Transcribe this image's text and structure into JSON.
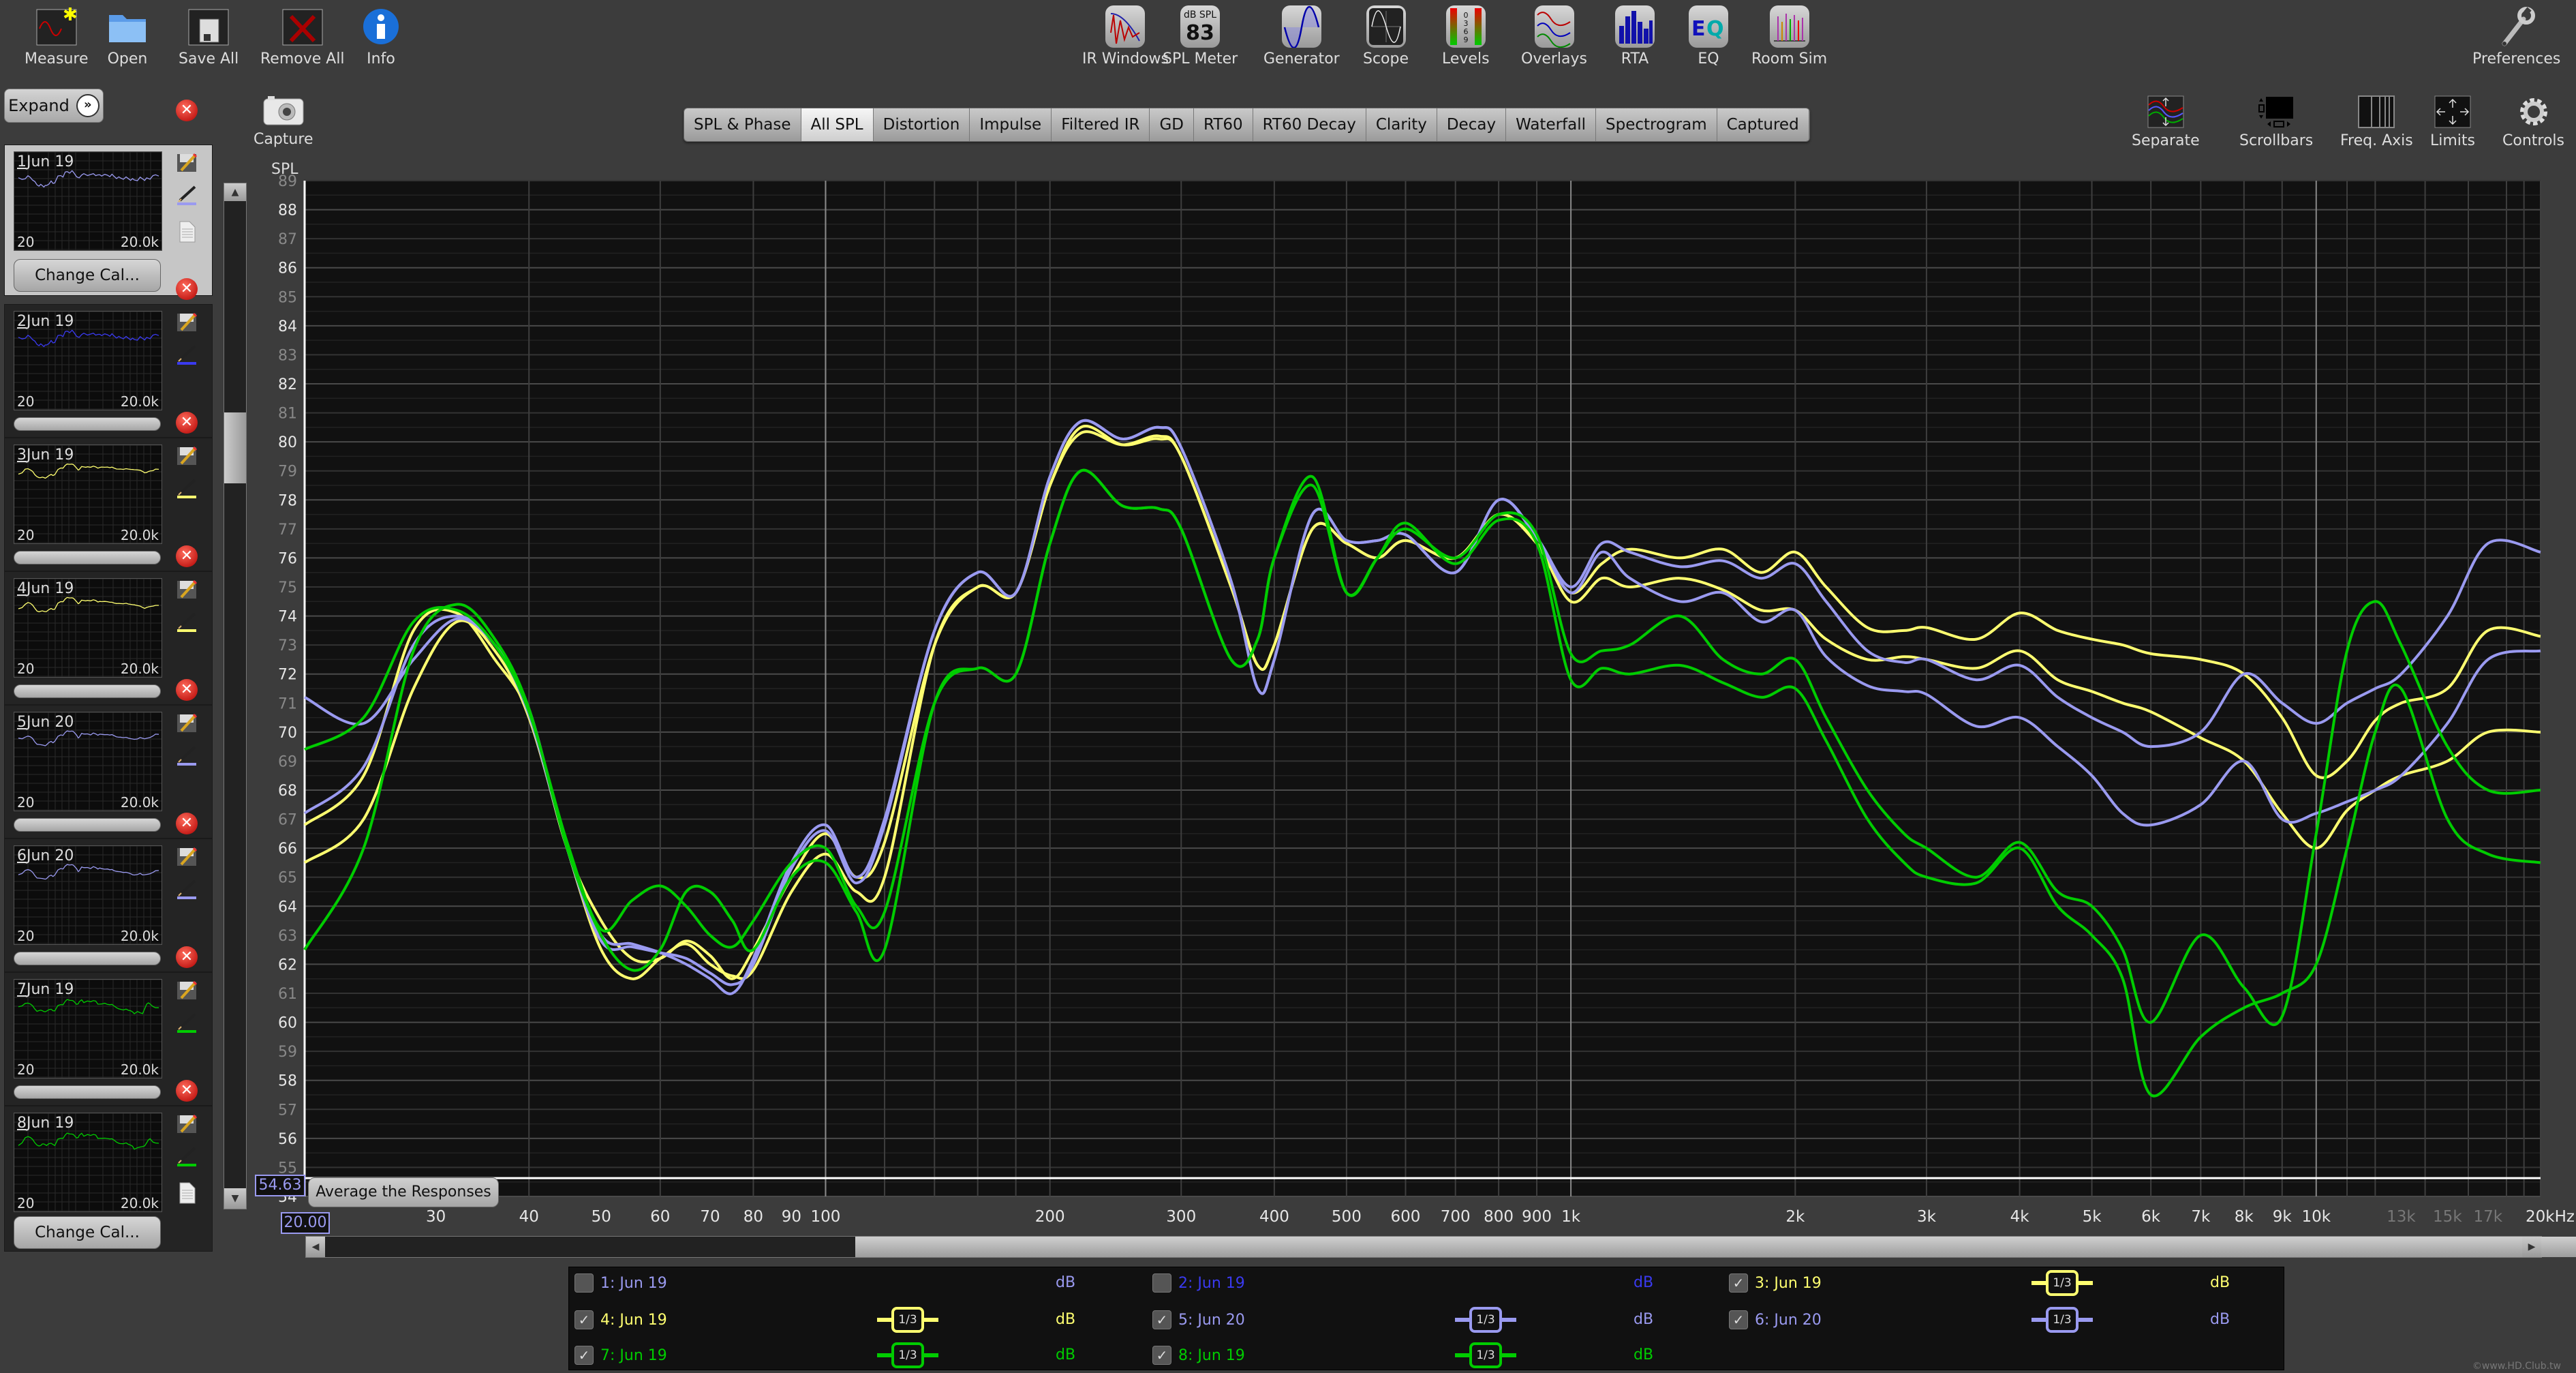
{
  "toolbar_left": [
    {
      "label": "Measure",
      "icon": "measure-icon"
    },
    {
      "label": "Open",
      "icon": "folder-icon"
    },
    {
      "label": "Save All",
      "icon": "save-all-icon"
    },
    {
      "label": "Remove All",
      "icon": "remove-all-icon"
    },
    {
      "label": "Info",
      "icon": "info-icon"
    }
  ],
  "toolbar_center": [
    {
      "label": "IR Windows",
      "icon": "ir-windows-icon"
    },
    {
      "label": "SPL Meter",
      "icon": "spl-meter-icon",
      "top": "dB SPL",
      "value": "83"
    },
    {
      "label": "Generator",
      "icon": "generator-icon"
    },
    {
      "label": "Scope",
      "icon": "scope-icon"
    },
    {
      "label": "Levels",
      "icon": "levels-icon"
    },
    {
      "label": "Overlays",
      "icon": "overlays-icon"
    },
    {
      "label": "RTA",
      "icon": "rta-icon"
    },
    {
      "label": "EQ",
      "icon": "eq-icon"
    },
    {
      "label": "Room Sim",
      "icon": "room-sim-icon"
    }
  ],
  "preferences": {
    "label": "Preferences",
    "icon": "wrench-icon"
  },
  "capture": {
    "label": "Capture",
    "icon": "camera-icon"
  },
  "right_controls": [
    {
      "label": "Separate",
      "icon": "separate-icon"
    },
    {
      "label": "Scrollbars",
      "icon": "scrollbars-icon"
    },
    {
      "label": "Freq. Axis",
      "icon": "freq-axis-icon"
    },
    {
      "label": "Limits",
      "icon": "limits-icon"
    },
    {
      "label": "Controls",
      "icon": "gear-icon"
    }
  ],
  "tabs": [
    {
      "label": "SPL & Phase",
      "active": false
    },
    {
      "label": "All SPL",
      "active": true
    },
    {
      "label": "Distortion",
      "active": false
    },
    {
      "label": "Impulse",
      "active": false
    },
    {
      "label": "Filtered IR",
      "active": false
    },
    {
      "label": "GD",
      "active": false
    },
    {
      "label": "RT60",
      "active": false
    },
    {
      "label": "RT60 Decay",
      "active": false
    },
    {
      "label": "Clarity",
      "active": false
    },
    {
      "label": "Decay",
      "active": false
    },
    {
      "label": "Waterfall",
      "active": false
    },
    {
      "label": "Spectrogram",
      "active": false
    },
    {
      "label": "Captured",
      "active": false
    }
  ],
  "expand_label": "Expand",
  "change_cal_label": "Change Cal...",
  "measurements": [
    {
      "num": "1",
      "name": "Jun 19",
      "color": "#9a9af0",
      "selected": true
    },
    {
      "num": "2",
      "name": "Jun 19",
      "color": "#3a3af0",
      "selected": false
    },
    {
      "num": "3",
      "name": "Jun 19",
      "color": "#ffff70",
      "selected": false
    },
    {
      "num": "4",
      "name": "Jun 19",
      "color": "#ffff70",
      "selected": false
    },
    {
      "num": "5",
      "name": "Jun 20",
      "color": "#9a9af0",
      "selected": false
    },
    {
      "num": "6",
      "name": "Jun 20",
      "color": "#9a9af0",
      "selected": false
    },
    {
      "num": "7",
      "name": "Jun 19",
      "color": "#00cc00",
      "selected": false
    },
    {
      "num": "8",
      "name": "Jun 19",
      "color": "#00cc00",
      "selected": false
    }
  ],
  "thumb_freq_low": "20",
  "thumb_freq_high": "20.0k",
  "average_button": "Average the Responses",
  "cursor_readout": {
    "spl": "54.63",
    "freq": "20.00"
  },
  "legend": [
    {
      "label": "1: Jun 19",
      "checked": false,
      "smoothing": "",
      "unit": "dB",
      "color": "#9a9af0"
    },
    {
      "label": "2: Jun 19",
      "checked": false,
      "smoothing": "",
      "unit": "dB",
      "color": "#3a3af0"
    },
    {
      "label": "3: Jun 19",
      "checked": true,
      "smoothing": "1/3",
      "unit": "dB",
      "color": "#ffff70"
    },
    {
      "label": "4: Jun 19",
      "checked": true,
      "smoothing": "1/3",
      "unit": "dB",
      "color": "#ffff70"
    },
    {
      "label": "5: Jun 20",
      "checked": true,
      "smoothing": "1/3",
      "unit": "dB",
      "color": "#9a9af0"
    },
    {
      "label": "6: Jun 20",
      "checked": true,
      "smoothing": "1/3",
      "unit": "dB",
      "color": "#9a9af0"
    },
    {
      "label": "7: Jun 19",
      "checked": true,
      "smoothing": "1/3",
      "unit": "dB",
      "color": "#00cc00"
    },
    {
      "label": "8: Jun 19",
      "checked": true,
      "smoothing": "1/3",
      "unit": "dB",
      "color": "#00cc00"
    }
  ],
  "watermark": "©www.HD.Club.tw",
  "chart_data": {
    "type": "line",
    "title": "All SPL",
    "ylabel": "SPL",
    "xlabel": "Hz",
    "xscale": "log",
    "xlim": [
      20,
      20000
    ],
    "ylim": [
      54,
      89
    ],
    "grid": true,
    "y_ticks": [
      54,
      55,
      56,
      57,
      58,
      59,
      60,
      61,
      62,
      63,
      64,
      65,
      66,
      67,
      68,
      69,
      70,
      71,
      72,
      73,
      74,
      75,
      76,
      77,
      78,
      79,
      80,
      81,
      82,
      83,
      84,
      85,
      86,
      87,
      88,
      89
    ],
    "x_ticks": [
      {
        "f": 30,
        "label": "30"
      },
      {
        "f": 40,
        "label": "40"
      },
      {
        "f": 50,
        "label": "50"
      },
      {
        "f": 60,
        "label": "60"
      },
      {
        "f": 70,
        "label": "70"
      },
      {
        "f": 80,
        "label": "80"
      },
      {
        "f": 90,
        "label": "90"
      },
      {
        "f": 100,
        "label": "100"
      },
      {
        "f": 200,
        "label": "200"
      },
      {
        "f": 300,
        "label": "300"
      },
      {
        "f": 400,
        "label": "400"
      },
      {
        "f": 500,
        "label": "500"
      },
      {
        "f": 600,
        "label": "600"
      },
      {
        "f": 700,
        "label": "700"
      },
      {
        "f": 800,
        "label": "800"
      },
      {
        "f": 900,
        "label": "900"
      },
      {
        "f": 1000,
        "label": "1k"
      },
      {
        "f": 2000,
        "label": "2k"
      },
      {
        "f": 3000,
        "label": "3k"
      },
      {
        "f": 4000,
        "label": "4k"
      },
      {
        "f": 5000,
        "label": "5k"
      },
      {
        "f": 6000,
        "label": "6k"
      },
      {
        "f": 7000,
        "label": "7k"
      },
      {
        "f": 8000,
        "label": "8k"
      },
      {
        "f": 9000,
        "label": "9k"
      },
      {
        "f": 10000,
        "label": "10k"
      },
      {
        "f": 13000,
        "label": "13k",
        "dim": true
      },
      {
        "f": 15000,
        "label": "15k",
        "dim": true
      },
      {
        "f": 17000,
        "label": "17k",
        "dim": true
      },
      {
        "f": 20000,
        "label": "20kHz"
      }
    ],
    "x": [
      20,
      24,
      28,
      32,
      36,
      40,
      45,
      50,
      55,
      60,
      65,
      70,
      75,
      80,
      90,
      100,
      110,
      120,
      140,
      160,
      180,
      200,
      220,
      250,
      280,
      300,
      350,
      380,
      400,
      450,
      500,
      550,
      600,
      700,
      800,
      900,
      1000,
      1100,
      1200,
      1400,
      1600,
      1800,
      2000,
      2200,
      2500,
      2800,
      3000,
      3500,
      4000,
      4500,
      5000,
      5500,
      6000,
      7000,
      8000,
      9000,
      10000,
      11000,
      12000,
      13000,
      15000,
      17000,
      20000
    ],
    "series": [
      {
        "name": "3: Jun 19",
        "color": "#ffff70",
        "values": [
          66.8,
          68.5,
          73.5,
          74.1,
          72.5,
          70.6,
          66.0,
          63.5,
          62.2,
          62.2,
          62.8,
          62.3,
          61.5,
          62.5,
          65.0,
          66.5,
          65.0,
          66.2,
          73.0,
          75.0,
          74.8,
          78.5,
          80.3,
          79.9,
          80.2,
          79.5,
          75.0,
          72.3,
          73.0,
          77.0,
          76.5,
          76.0,
          76.6,
          76.0,
          77.5,
          76.5,
          74.8,
          75.8,
          76.3,
          76.0,
          76.3,
          75.5,
          76.2,
          75.0,
          73.6,
          73.5,
          73.6,
          73.2,
          74.1,
          73.5,
          73.2,
          73.0,
          72.7,
          72.5,
          72.0,
          70.5,
          68.5,
          69.0,
          70.4,
          71.0,
          71.5,
          73.5,
          73.3
        ]
      },
      {
        "name": "4: Jun 19",
        "color": "#ffff70",
        "values": [
          65.5,
          67.0,
          71.5,
          73.8,
          72.8,
          70.5,
          66.0,
          62.5,
          61.5,
          62.2,
          62.7,
          62.0,
          61.6,
          61.8,
          64.5,
          65.8,
          64.5,
          65.0,
          73.0,
          75.0,
          74.8,
          78.5,
          80.5,
          79.9,
          80.1,
          79.5,
          75.0,
          72.3,
          73.0,
          77.0,
          76.5,
          76.0,
          76.6,
          76.0,
          77.5,
          76.5,
          74.5,
          75.3,
          75.0,
          75.3,
          74.9,
          74.2,
          74.2,
          73.2,
          72.5,
          72.6,
          72.5,
          72.2,
          72.8,
          71.8,
          71.4,
          71.0,
          70.7,
          69.8,
          69.0,
          67.2,
          66.0,
          67.3,
          68.0,
          68.5,
          69.0,
          70.0,
          70.0
        ]
      },
      {
        "name": "5: Jun 20",
        "color": "#9a9af0",
        "values": [
          71.2,
          70.3,
          72.5,
          73.9,
          73.0,
          70.8,
          66.0,
          63.0,
          62.7,
          62.4,
          62.0,
          61.5,
          61.0,
          62.2,
          65.5,
          66.8,
          65.0,
          67.0,
          73.5,
          75.5,
          74.8,
          78.8,
          80.7,
          80.1,
          80.5,
          79.8,
          75.2,
          71.5,
          72.5,
          77.5,
          76.6,
          76.6,
          76.8,
          75.5,
          78.0,
          76.7,
          75.0,
          76.5,
          76.2,
          75.7,
          75.9,
          75.3,
          75.8,
          74.5,
          72.8,
          72.4,
          72.5,
          71.8,
          72.3,
          71.2,
          70.5,
          70.0,
          69.5,
          70.0,
          72.0,
          71.0,
          70.3,
          71.0,
          71.5,
          72.0,
          74.0,
          76.5,
          76.2
        ]
      },
      {
        "name": "6: Jun 20",
        "color": "#9a9af0",
        "values": [
          67.2,
          68.8,
          73.0,
          74.0,
          73.0,
          70.6,
          66.0,
          62.8,
          62.6,
          62.4,
          62.2,
          61.7,
          61.3,
          62.0,
          65.3,
          66.6,
          64.8,
          66.8,
          73.5,
          75.5,
          74.8,
          78.8,
          80.7,
          80.1,
          80.5,
          79.8,
          75.2,
          71.5,
          72.5,
          77.5,
          76.6,
          76.6,
          76.8,
          75.5,
          78.0,
          76.7,
          74.8,
          76.2,
          75.3,
          74.5,
          74.8,
          73.8,
          74.2,
          72.6,
          71.6,
          71.4,
          71.3,
          70.2,
          70.5,
          69.5,
          68.5,
          67.2,
          66.8,
          67.5,
          69.0,
          67.0,
          67.2,
          67.6,
          68.0,
          68.5,
          70.3,
          72.5,
          72.8
        ]
      },
      {
        "name": "7: Jun 19",
        "color": "#00cc00",
        "values": [
          69.4,
          70.5,
          73.8,
          74.2,
          73.0,
          70.7,
          66.2,
          63.2,
          64.2,
          64.7,
          64.0,
          63.0,
          62.6,
          63.5,
          65.5,
          66.0,
          64.0,
          63.8,
          71.0,
          72.2,
          72.0,
          76.5,
          79.0,
          77.8,
          77.7,
          77.0,
          72.5,
          73.2,
          76.0,
          78.5,
          74.8,
          76.0,
          77.0,
          76.0,
          77.5,
          76.8,
          72.7,
          72.8,
          73.0,
          74.0,
          72.5,
          72.0,
          72.5,
          70.5,
          68.0,
          66.5,
          66.0,
          65.0,
          66.2,
          64.5,
          64.0,
          62.5,
          60.0,
          63.0,
          61.2,
          60.2,
          66.5,
          72.8,
          74.5,
          73.0,
          69.5,
          68.0,
          68.0
        ]
      },
      {
        "name": "8: Jun 19",
        "color": "#00cc00",
        "values": [
          62.5,
          66.0,
          72.8,
          74.4,
          73.2,
          70.8,
          66.0,
          63.0,
          61.8,
          62.5,
          64.5,
          64.5,
          63.5,
          62.5,
          65.0,
          65.5,
          63.8,
          62.5,
          71.0,
          72.2,
          72.0,
          76.5,
          79.0,
          77.8,
          77.7,
          77.0,
          72.5,
          73.2,
          76.0,
          78.8,
          74.8,
          76.0,
          77.2,
          75.8,
          77.3,
          76.5,
          71.8,
          72.2,
          72.0,
          72.3,
          71.7,
          71.2,
          71.5,
          69.7,
          67.0,
          65.5,
          65.0,
          64.8,
          66.0,
          64.0,
          63.0,
          61.5,
          57.5,
          59.5,
          60.5,
          61.0,
          62.0,
          66.0,
          70.0,
          71.5,
          67.0,
          65.8,
          65.5
        ]
      }
    ]
  }
}
